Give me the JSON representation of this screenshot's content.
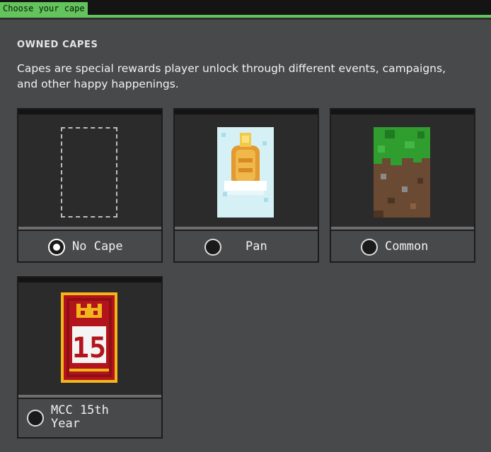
{
  "window": {
    "tab_title": "Choose your cape"
  },
  "section": {
    "title": "OWNED CAPES",
    "description": "Capes are special rewards player unlock through different events, campaigns, and other happy happenings."
  },
  "capes": [
    {
      "label": "No Cape",
      "selected": true
    },
    {
      "label": "Pan",
      "selected": false
    },
    {
      "label": "Common",
      "selected": false
    },
    {
      "label_line1": "MCC 15th",
      "label_line2": "Year",
      "selected": false
    }
  ],
  "badge_number": "15",
  "colors": {
    "accent": "#62c45a",
    "panel": "#48494a",
    "card_dark": "#2b2b2b",
    "pan_sky": "#c8ecf2",
    "pan_gold": "#e39a2e",
    "grass": "#2f9e2f",
    "dirt": "#6b4a33",
    "mcc_red": "#b3141b",
    "mcc_gold": "#f2b61c"
  }
}
